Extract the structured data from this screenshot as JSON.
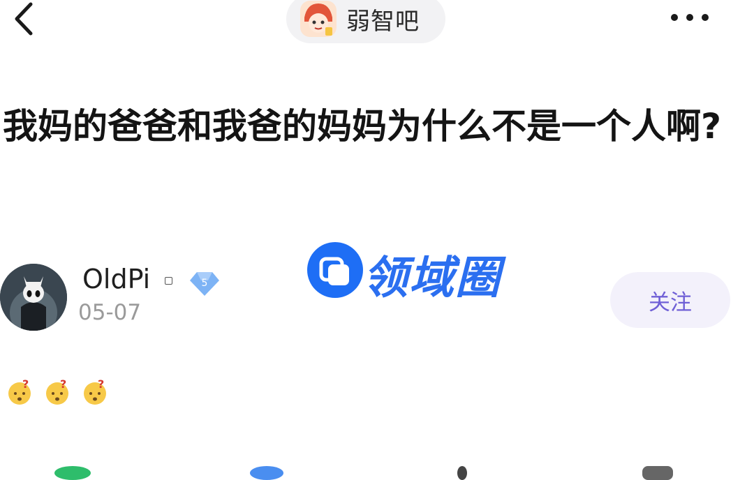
{
  "topbar": {
    "forum_name": "弱智吧",
    "back_icon": "chevron-left-icon",
    "more_icon": "more-dots-icon"
  },
  "post": {
    "title": "我妈的爸爸和我爸的妈妈为什么不是一个人啊?",
    "author": {
      "name": "OldPi",
      "level": "5",
      "date": "05-07"
    },
    "follow_label": "关注",
    "body_emojis": [
      "confused-face-emoji",
      "confused-face-emoji",
      "confused-face-emoji"
    ]
  },
  "watermark": {
    "text": "领域圈"
  },
  "colors": {
    "follow_text": "#6f5fd6",
    "follow_bg": "#f3f1fb",
    "badge": "#6fa8f2",
    "watermark": "#2b6ff0"
  }
}
